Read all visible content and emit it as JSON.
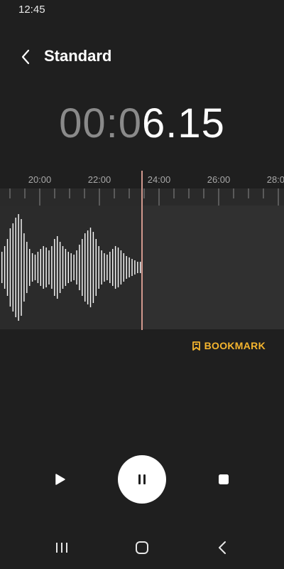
{
  "status_bar": {
    "time": "12:45"
  },
  "header": {
    "title": "Standard"
  },
  "timer": {
    "dim": "00:0",
    "bright": "6.15"
  },
  "timeline": {
    "labels": [
      "20:00",
      "22:00",
      "24:00",
      "26:00",
      "28:00"
    ],
    "recorded_fraction_visible": 0.5
  },
  "bookmark": {
    "label": "BOOKMARK"
  },
  "icons": {
    "back": "chevron-left-icon",
    "play": "play-icon",
    "pause": "pause-icon",
    "stop": "stop-icon",
    "bookmark": "bookmark-icon",
    "recents": "recents-icon",
    "home": "home-icon",
    "nav_back": "back-icon"
  },
  "colors": {
    "background": "#1f1f1f",
    "accent": "#f5b52e",
    "playhead": "#d2998e",
    "waveform": "#ffffff"
  }
}
